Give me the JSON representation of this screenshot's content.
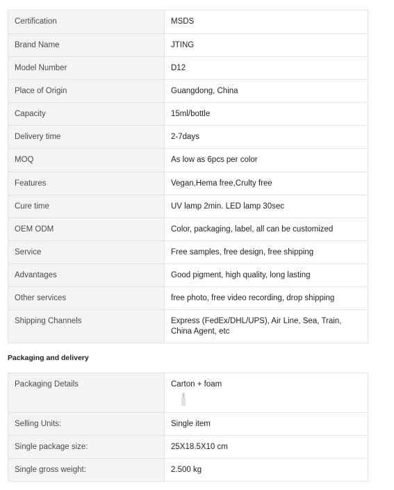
{
  "attributes": [
    {
      "key": "Certification",
      "value": "MSDS"
    },
    {
      "key": "Brand Name",
      "value": "JTING"
    },
    {
      "key": "Model Number",
      "value": "D12"
    },
    {
      "key": "Place of Origin",
      "value": "Guangdong, China"
    },
    {
      "key": "Capacity",
      "value": "15ml/bottle"
    },
    {
      "key": "Delivery time",
      "value": "2-7days"
    },
    {
      "key": "MOQ",
      "value": "As low as 6pcs per color"
    },
    {
      "key": "Features",
      "value": "Vegan,Hema free,Crulty free"
    },
    {
      "key": "Cure time",
      "value": "UV lamp 2min. LED lamp 30sec"
    },
    {
      "key": "OEM ODM",
      "value": "Color, packaging, label, all can be customized"
    },
    {
      "key": "Service",
      "value": "Free samples, free design, free shipping"
    },
    {
      "key": "Advantages",
      "value": "Good pigment, high quality, long lasting"
    },
    {
      "key": "Other services",
      "value": "free photo, free video recording, drop shipping"
    },
    {
      "key": "Shipping Channels",
      "value": "Express (FedEx/DHL/UPS), Air Line, Sea, Train, China Agent, etc"
    }
  ],
  "packaging": {
    "title": "Packaging and delivery",
    "rows": [
      {
        "key": "Packaging Details",
        "value": "Carton + foam",
        "image_icon": "bottle-thumbnail-icon"
      },
      {
        "key": "Selling Units:",
        "value": "Single item"
      },
      {
        "key": "Single package size:",
        "value": "25X18.5X10 cm"
      },
      {
        "key": "Single gross weight:",
        "value": "2.500 kg"
      }
    ]
  }
}
